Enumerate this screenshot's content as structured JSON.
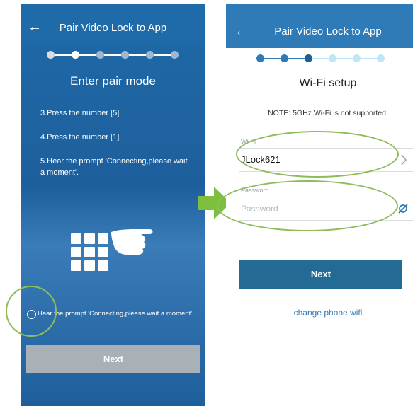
{
  "left_screen": {
    "title": "Pair Video Lock to App",
    "back_icon": "←",
    "heading": "Enter pair mode",
    "instructions": [
      "3.Press the number [5]",
      "4.Press the number [1]",
      "5.Hear the prompt 'Connecting,please wait a moment'."
    ],
    "checkbox_label": "Hear the prompt 'Connecting,please wait a moment'",
    "next_label": "Next",
    "progress": {
      "current_step": 2,
      "total_steps": 6
    }
  },
  "right_screen": {
    "title": "Pair Video Lock to App",
    "back_icon": "←",
    "heading": "Wi-Fi setup",
    "note": "NOTE: 5GHz Wi-Fi is not supported.",
    "wifi_label": "Wi-Fi",
    "wifi_value": "JLock621",
    "password_label": "Password",
    "password_placeholder": "Password",
    "next_label": "Next",
    "change_wifi_label": "change phone wifi",
    "progress": {
      "current_step": 3,
      "total_steps": 6
    }
  },
  "icons": {
    "back": "arrow-left-icon",
    "keypad": "keypad-icon",
    "hand": "pointing-hand-icon",
    "chevron": "chevron-right-icon",
    "eye": "eye-hidden-icon",
    "arrow": "green-arrow-right-icon"
  },
  "colors": {
    "left_bg": "#1f6aa8",
    "right_header": "#2f7bb8",
    "right_button": "#236a95",
    "highlight": "#8dbd5a",
    "left_button": "#a9b0b6"
  }
}
